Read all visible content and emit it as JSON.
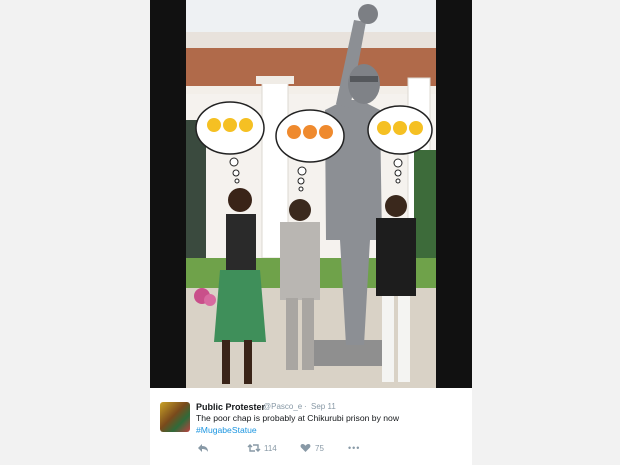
{
  "tweet": {
    "author_name": "Public Protester",
    "handle": "@Pasco_e",
    "separator": "·",
    "timestamp": "Sep 11",
    "text": "The poor chap is probably at Chikurubi prison by now",
    "hashtag": "#MugabeStatue",
    "retweets": "114",
    "likes": "75"
  },
  "actions": {
    "reply_icon": "reply-icon",
    "retweet_icon": "retweet-icon",
    "like_icon": "heart-icon",
    "more_icon": "more-icon",
    "more_glyph": "•••"
  },
  "colors": {
    "background": "#f2f2f2",
    "link": "#1b95e0",
    "muted": "#8899a6",
    "text": "#14171a"
  }
}
